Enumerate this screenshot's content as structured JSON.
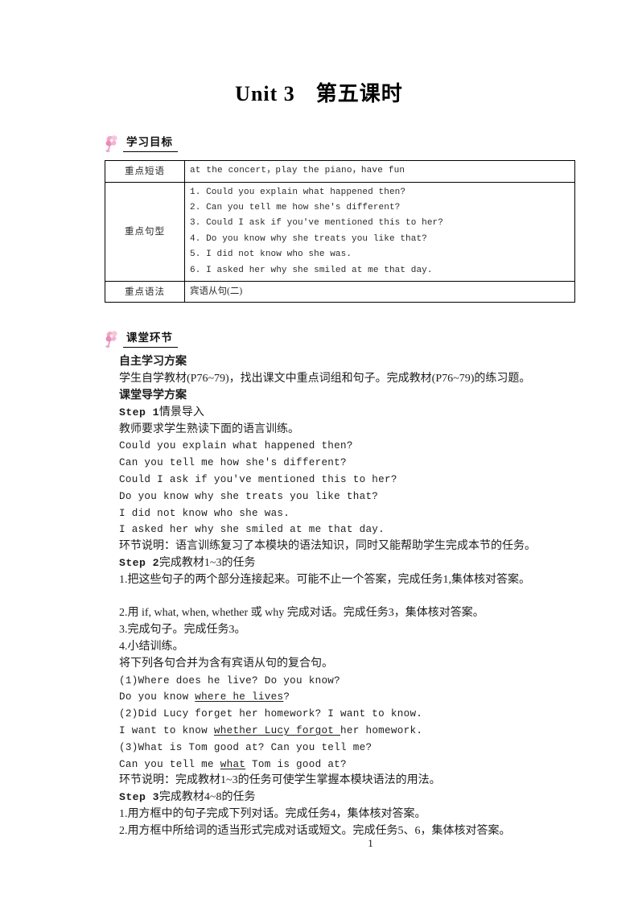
{
  "document": {
    "title_unit": "Unit 3",
    "title_lesson": "第五课时",
    "page_number": "1"
  },
  "sections": {
    "objectives_heading": "学习目标",
    "classroom_heading": "课堂环节"
  },
  "key_points_table": {
    "rows": [
      {
        "label": "重点短语",
        "value": "at the concert，play the piano，have fun"
      },
      {
        "label": "重点句型",
        "value": ""
      },
      {
        "label": "重点语法",
        "value": "宾语从句(二)"
      }
    ],
    "sentences": [
      "1. Could you explain what happened then?",
      "2. Can you tell me how she's different?",
      "3. Could I ask if you've mentioned this to her?",
      "4. Do you know why she treats you like that?",
      "5. I did not know who she was.",
      "6. I asked her why she smiled at me that day."
    ]
  },
  "content": {
    "self_study_heading": "自主学习方案",
    "self_study_text": "学生自学教材(P76~79)，找出课文中重点词组和句子。完成教材(P76~79)的练习题。",
    "guided_heading": "课堂导学方案",
    "step1_label": "Step 1",
    "step1_title": "情景导入",
    "step1_intro": "教师要求学生熟读下面的语言训练。",
    "step1_sentences": [
      "Could you explain what happened then?",
      "Can you tell me how she's different?",
      "Could I ask if you've mentioned this to her?",
      "Do you know why she treats you like that?",
      "I did not know who she was.",
      "I asked her why she smiled at me that day."
    ],
    "step1_note": "环节说明：语言训练复习了本模块的语法知识，同时又能帮助学生完成本节的任务。",
    "step2_label": "Step 2",
    "step2_title": "完成教材1~3的任务",
    "step2_item1": "1.把这些句子的两个部分连接起来。可能不止一个答案，完成任务1,集体核对答案。",
    "step2_item2": "2.用 if, what, when, whether 或 why 完成对话。完成任务3，集体核对答案。",
    "step2_item3": "3.完成句子。完成任务3。",
    "step2_item4": "4.小结训练。",
    "merge_instruction": "将下列各句合并为含有宾语从句的复合句。",
    "exercises": [
      {
        "question": "(1)Where does he live? Do you know?",
        "answer_before": "Do you know ",
        "answer_underlined": "where he lives",
        "answer_after": "?"
      },
      {
        "question": "(2)Did Lucy forget her homework? I want to know.",
        "answer_before": "I want to know ",
        "answer_underlined": "whether Lucy forgot ",
        "answer_after": "her homework."
      },
      {
        "question": "(3)What is Tom good at? Can you tell me?",
        "answer_before": "Can you tell me ",
        "answer_underlined": "what",
        "answer_after": " Tom is good at?"
      }
    ],
    "step2_note": "环节说明：完成教材1~3的任务可使学生掌握本模块语法的用法。",
    "step3_label": "Step 3",
    "step3_title": "完成教材4~8的任务",
    "step3_item1": "1.用方框中的句子完成下列对话。完成任务4，集体核对答案。",
    "step3_item2": "2.用方框中所给词的适当形式完成对话或短文。完成任务5、6，集体核对答案。"
  }
}
